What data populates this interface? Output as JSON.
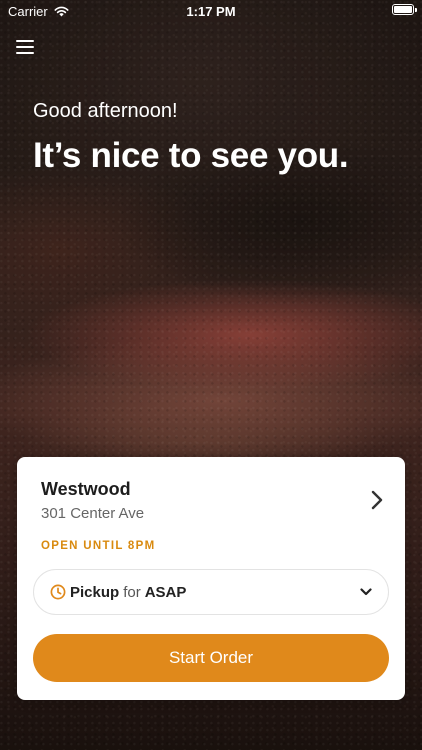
{
  "status_bar": {
    "carrier": "Carrier",
    "time": "1:17 PM",
    "icons": [
      "wifi-icon",
      "battery-icon"
    ]
  },
  "header": {
    "menu_icon": "hamburger-menu-icon",
    "greeting": "Good afternoon!",
    "headline": "It’s nice to see you."
  },
  "location_card": {
    "name": "Westwood",
    "address": "301 Center Ave",
    "open_status": "OPEN UNTIL 8PM",
    "order": {
      "mode": "Pickup",
      "connector": "for",
      "time": "ASAP"
    },
    "start_button": "Start Order"
  },
  "colors": {
    "accent": "#e0891b",
    "open_status": "#d98a0f"
  }
}
